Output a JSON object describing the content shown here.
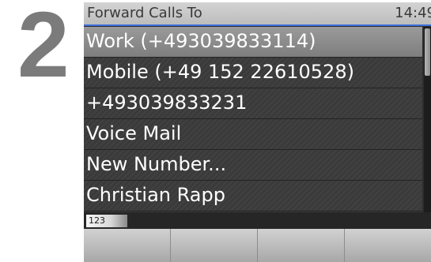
{
  "step": {
    "number": "2"
  },
  "header": {
    "title": "Forward Calls To",
    "time": "14:49"
  },
  "list": {
    "items": [
      {
        "label": "Work (+493039833114)",
        "selected": true
      },
      {
        "label": "Mobile (+49 152 22610528)",
        "selected": false
      },
      {
        "label": "+493039833231",
        "selected": false
      },
      {
        "label": "Voice Mail",
        "selected": false
      },
      {
        "label": "New Number...",
        "selected": false
      },
      {
        "label": "Christian Rapp",
        "selected": false
      }
    ]
  },
  "input_mode": {
    "label": "123"
  },
  "softkeys": [
    "",
    "",
    "",
    ""
  ],
  "colors": {
    "accent": "#3f6fd8",
    "step_number": "#7b7b7b",
    "screen_bg": "#2d2d2d"
  }
}
